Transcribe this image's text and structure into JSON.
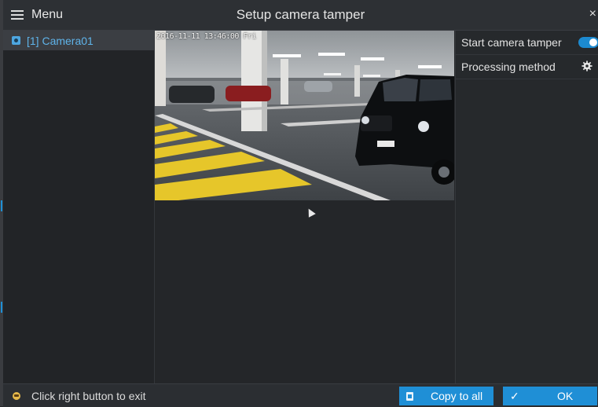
{
  "window": {
    "menu_label": "Menu",
    "title": "Setup camera tamper",
    "close_symbol": "×"
  },
  "channels": [
    {
      "label": "[1] Camera01",
      "icon": "camera-icon",
      "selected": true
    }
  ],
  "preview": {
    "osd_timestamp": "2016-11-11  13:46:00 Fri"
  },
  "settings": {
    "tamper_label": "Start camera tamper",
    "tamper_enabled": true,
    "processing_label": "Processing method",
    "processing_icon": "gear-icon"
  },
  "footer": {
    "hint": "Click right button to exit",
    "copy_label": "Copy to all",
    "ok_label": "OK",
    "ok_icon": "check-icon"
  },
  "colors": {
    "accent": "#1f8fd6",
    "selected_text": "#5fb4ea",
    "background": "#25272a"
  }
}
